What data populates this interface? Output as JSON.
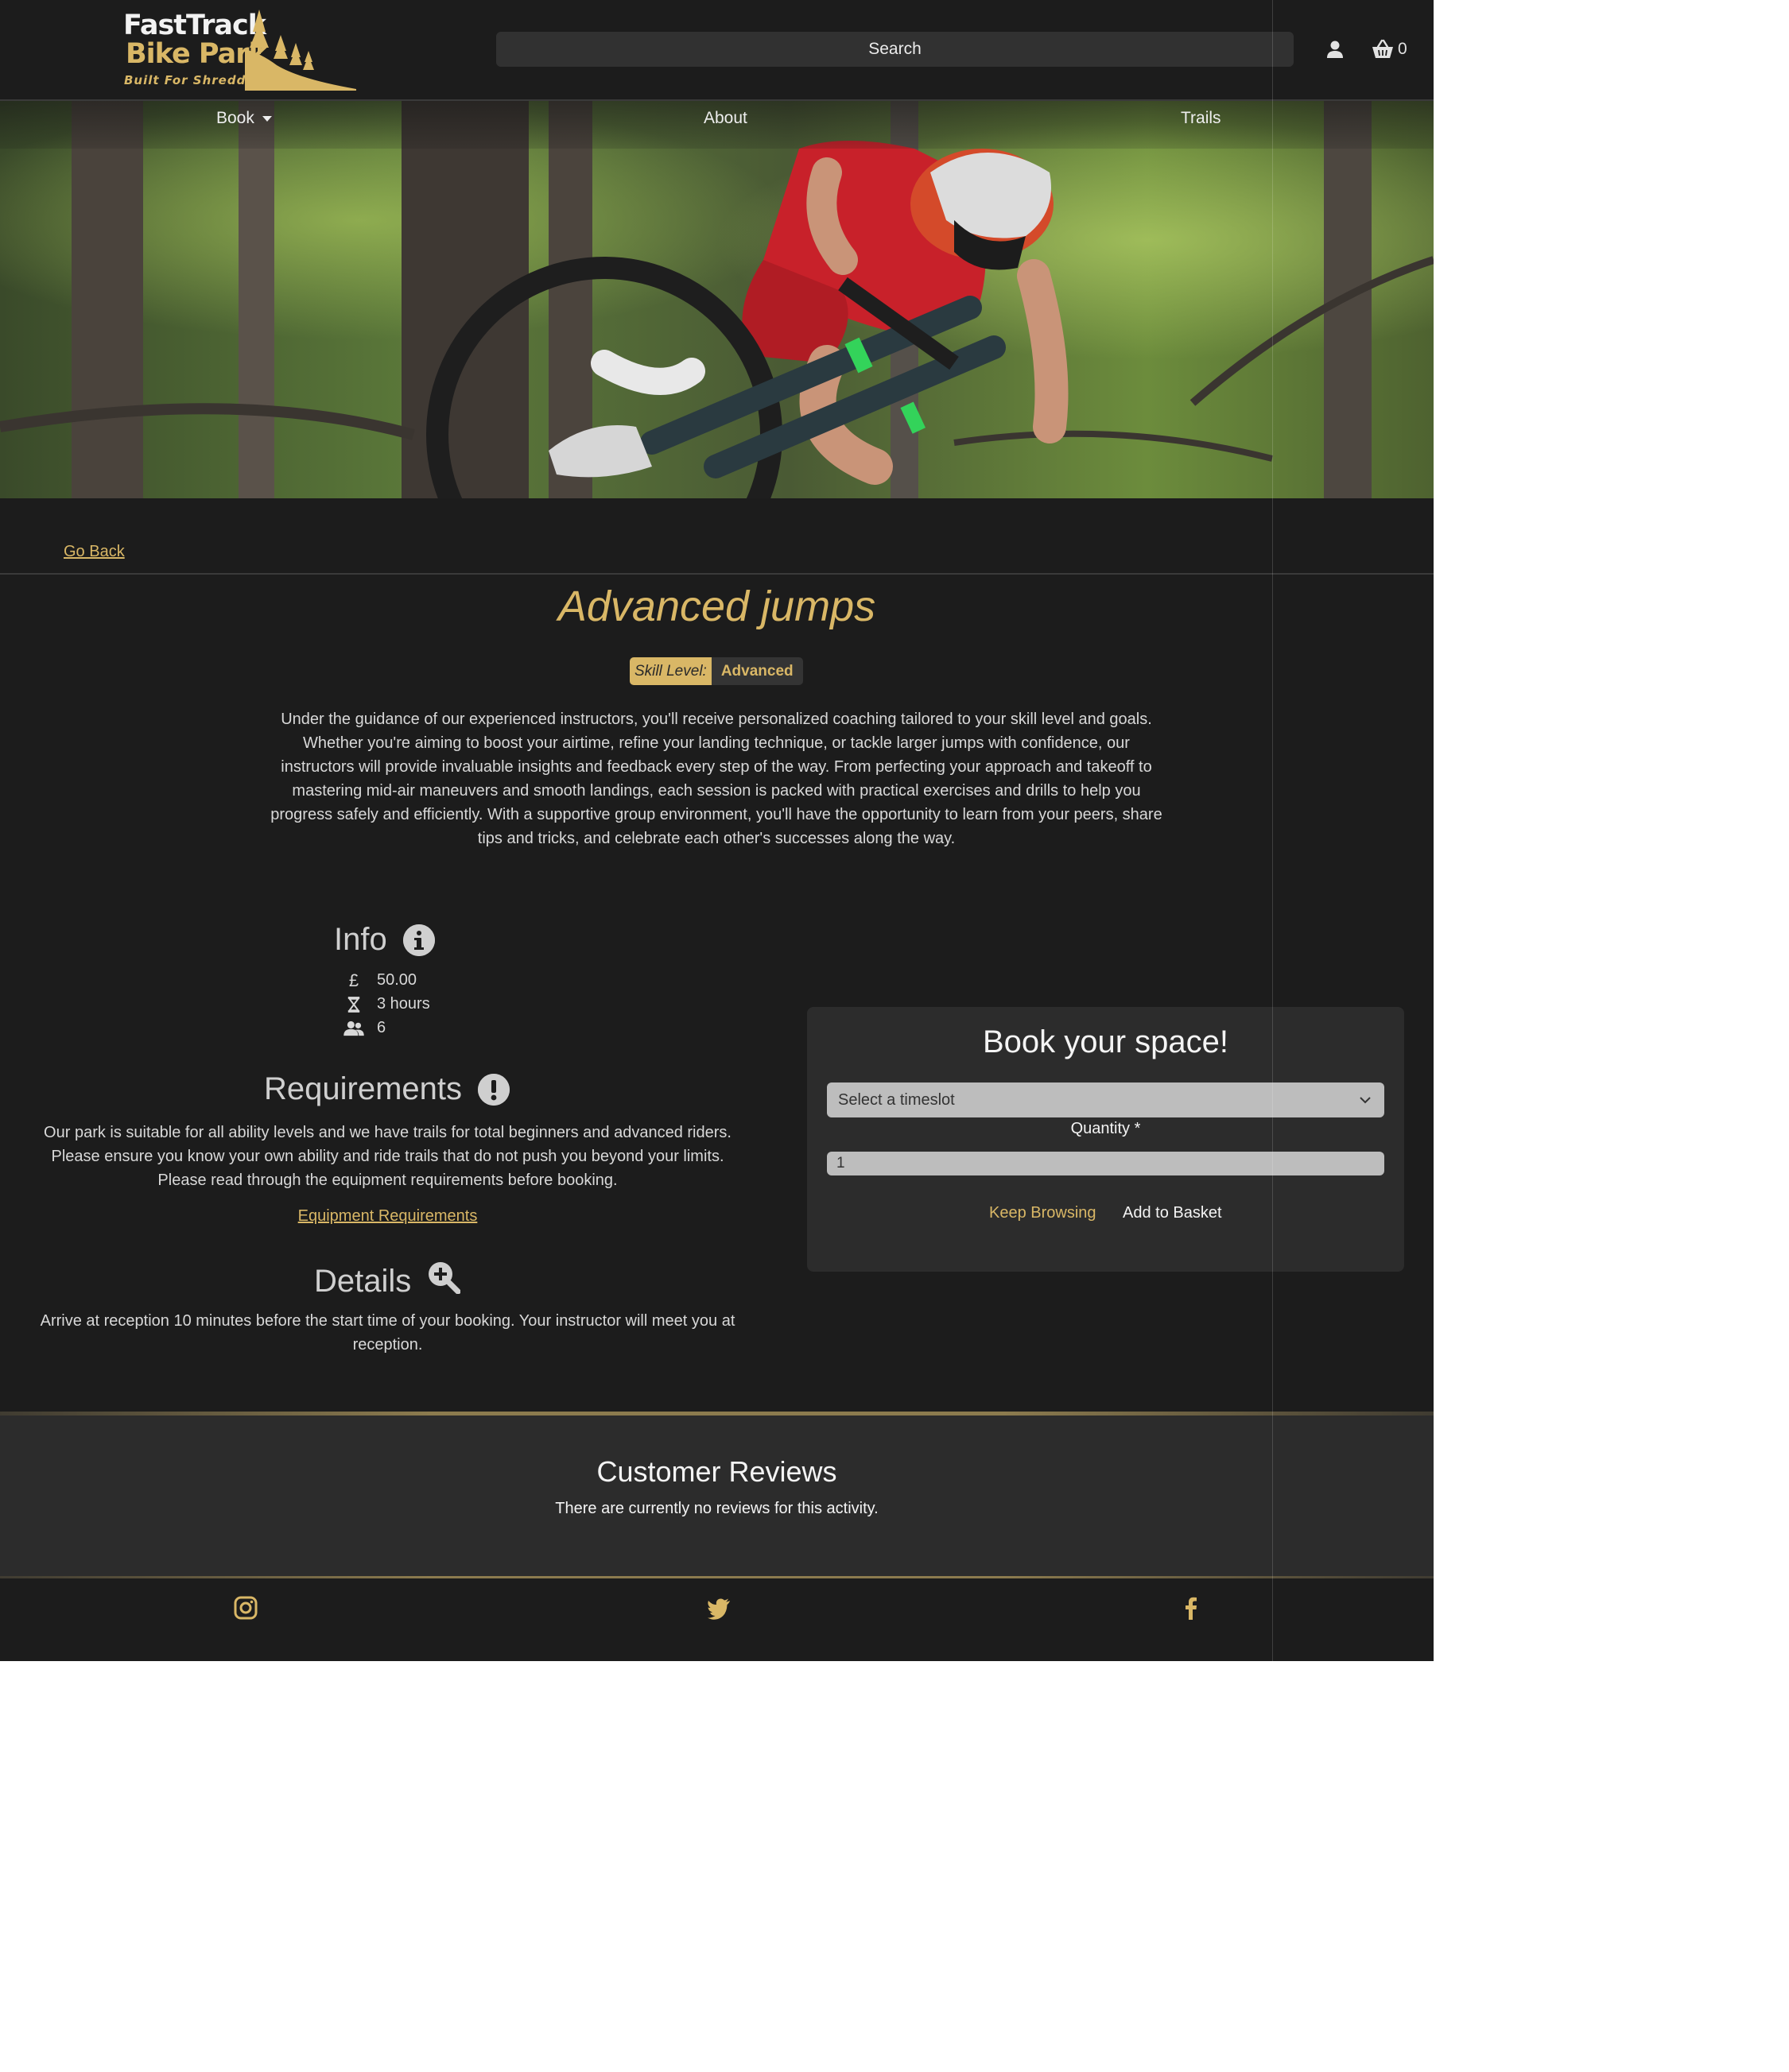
{
  "brand": {
    "name_line1": "FastTrack",
    "name_line2": "Bike Park",
    "tagline": "Built For Shredding",
    "accent_color": "#d9b766"
  },
  "header": {
    "search_label": "Search",
    "account_icon": "user-icon",
    "basket_icon": "basket-icon",
    "basket_count": "0"
  },
  "nav": {
    "items": [
      {
        "label": "Book",
        "has_dropdown": true
      },
      {
        "label": "About"
      },
      {
        "label": "Trails"
      }
    ]
  },
  "page": {
    "go_back": "Go Back",
    "title": "Advanced jumps",
    "skill_label": "Skill Level:",
    "skill_value": "Advanced",
    "description": "Under the guidance of our experienced instructors, you'll receive personalized coaching tailored to your skill level and goals. Whether you're aiming to boost your airtime, refine your landing technique, or tackle larger jumps with confidence, our instructors will provide invaluable insights and feedback every step of the way. From perfecting your approach and takeoff to mastering mid-air maneuvers and smooth landings, each session is packed with practical exercises and drills to help you progress safely and efficiently. With a supportive group environment, you'll have the opportunity to learn from your peers, share tips and tricks, and celebrate each other's successes along the way."
  },
  "info": {
    "heading": "Info",
    "icon": "info-icon",
    "price_icon": "pound-icon",
    "price": "50.00",
    "duration_icon": "hourglass-icon",
    "duration": "3 hours",
    "capacity_icon": "users-icon",
    "capacity": "6"
  },
  "requirements": {
    "heading": "Requirements",
    "icon": "exclamation-icon",
    "text": "Our park is suitable for all ability levels and we have trails for total beginners and advanced riders. Please ensure you know your own ability and ride trails that do not push you beyond your limits. Please read through the equipment requirements before booking.",
    "link": "Equipment Requirements"
  },
  "details": {
    "heading": "Details",
    "icon": "zoom-in-icon",
    "text": "Arrive at reception 10 minutes before the start time of your booking. Your instructor will meet you at reception."
  },
  "booking": {
    "title": "Book your space!",
    "timeslot_placeholder": "Select a timeslot",
    "quantity_label": "Quantity *",
    "quantity_value": "1",
    "keep_browsing": "Keep Browsing",
    "add_to_basket": "Add to Basket"
  },
  "reviews": {
    "title": "Customer Reviews",
    "empty_text": "There are currently no reviews for this activity."
  },
  "footer": {
    "social": [
      "instagram-icon",
      "twitter-icon",
      "facebook-icon"
    ]
  }
}
